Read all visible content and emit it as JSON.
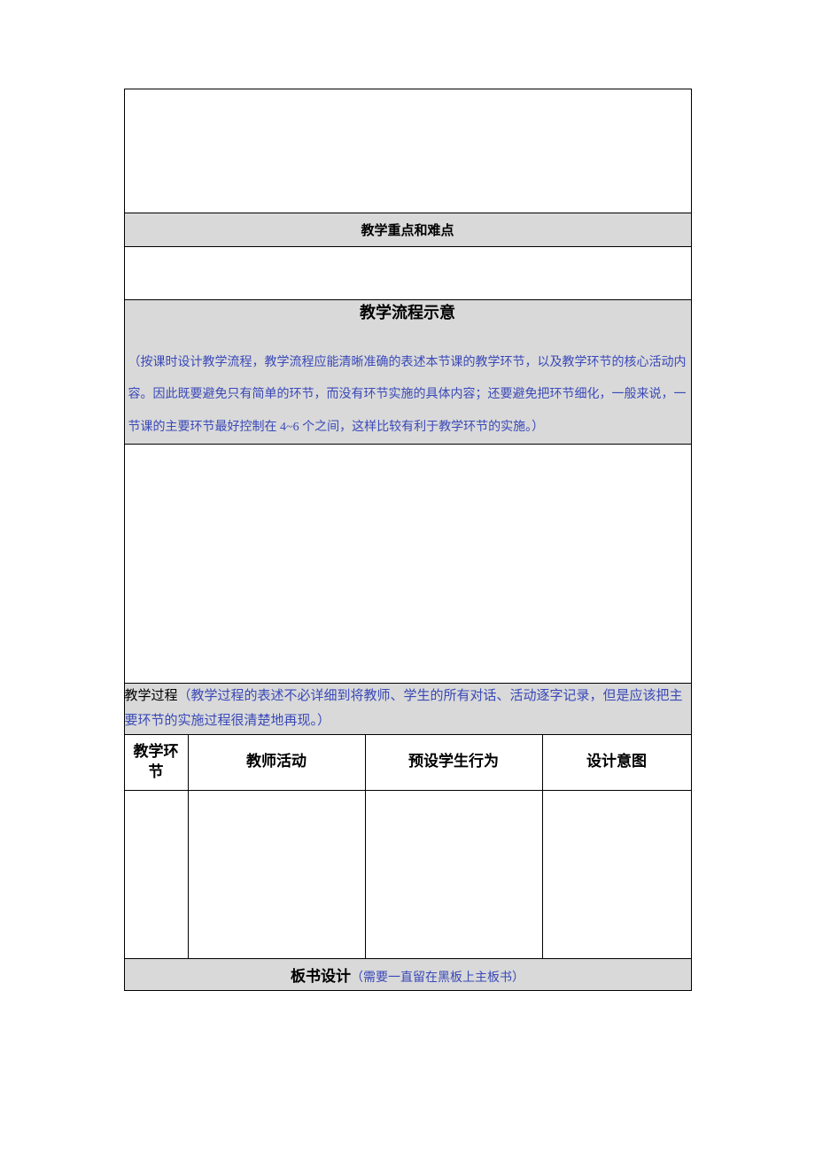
{
  "sections": {
    "keypoints_title": "教学重点和难点",
    "flow_title": "教学流程示意",
    "flow_note": "（按课时设计教学流程，教学流程应能清晰准确的表述本节课的教学环节，以及教学环节的核心活动内容。因此既要避免只有简单的环节，而没有环节实施的具体内容；还要避免把环节细化，一般来说，一节课的主要环节最好控制在 4~6 个之间，这样比较有利于教学环节的实施。）",
    "process_label": "教学过程",
    "process_note": "（教学过程的表述不必详细到将教师、学生的所有对话、活动逐字记录，但是应该把主要环节的实施过程很清楚地再现。）",
    "columns": {
      "c1": "教学环节",
      "c2": "教师活动",
      "c3": "预设学生行为",
      "c4": "设计意图"
    },
    "board_title": "板书设计",
    "board_note": "（需要一直留在黑板上主板书）"
  }
}
